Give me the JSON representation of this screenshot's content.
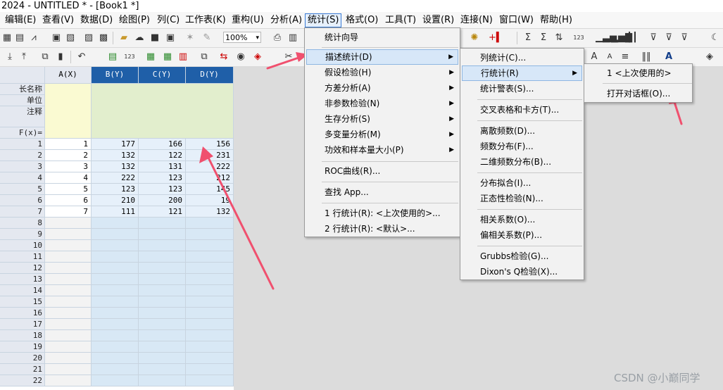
{
  "window": {
    "title": "2024 - UNTITLED * - [Book1 *]"
  },
  "menubar": [
    {
      "label": "编辑(E)"
    },
    {
      "label": "查看(V)"
    },
    {
      "label": "数据(D)"
    },
    {
      "label": "绘图(P)"
    },
    {
      "label": "列(C)"
    },
    {
      "label": "工作表(K)"
    },
    {
      "label": "重构(U)"
    },
    {
      "label": "分析(A)"
    },
    {
      "label": "统计(S)"
    },
    {
      "label": "格式(O)"
    },
    {
      "label": "工具(T)"
    },
    {
      "label": "设置(R)"
    },
    {
      "label": "连接(N)"
    },
    {
      "label": "窗口(W)"
    },
    {
      "label": "帮助(H)"
    }
  ],
  "toolbar": {
    "zoom": "100%"
  },
  "sheet": {
    "columns": [
      "A(X)",
      "B(Y)",
      "C(Y)",
      "D(Y)"
    ],
    "meta_rows": [
      "长名称",
      "单位",
      "注释",
      "F(x)="
    ],
    "rows": [
      [
        "1",
        "177",
        "166",
        "156"
      ],
      [
        "2",
        "132",
        "122",
        "231"
      ],
      [
        "3",
        "132",
        "131",
        "222"
      ],
      [
        "4",
        "222",
        "123",
        "212"
      ],
      [
        "5",
        "123",
        "123",
        "145"
      ],
      [
        "6",
        "210",
        "200",
        "19"
      ],
      [
        "7",
        "111",
        "121",
        "132"
      ]
    ],
    "row_numbers": [
      "1",
      "2",
      "3",
      "4",
      "5",
      "6",
      "7",
      "8",
      "9",
      "10",
      "11",
      "12",
      "13",
      "14",
      "15",
      "16",
      "17",
      "18",
      "19",
      "20",
      "21",
      "22"
    ]
  },
  "menu_stats": {
    "items": [
      "统计向导",
      "描述统计(D)",
      "假设检验(H)",
      "方差分析(A)",
      "非参数检验(N)",
      "生存分析(S)",
      "多变量分析(M)",
      "功效和样本量大小(P)",
      "ROC曲线(R)...",
      "查找 App...",
      "1 行统计(R): <上次使用的>...",
      "2 行统计(R): <默认>..."
    ]
  },
  "menu_desc": {
    "items": [
      "列统计(C)...",
      "行统计(R)",
      "统计警表(S)...",
      "交叉表格和卡方(T)...",
      "离散频数(D)...",
      "频数分布(F)...",
      "二维频数分布(B)...",
      "分布拟合(I)...",
      "正态性检验(N)...",
      "相关系数(O)...",
      "偏相关系数(P)...",
      "Grubbs检验(G)...",
      "Dixon's Q检验(X)..."
    ]
  },
  "menu_row": {
    "items": [
      "1 <上次使用的>",
      "打开对话框(O)..."
    ]
  },
  "watermark": "CSDN @小巅同学",
  "colors": {
    "accent": "#3a7bd5",
    "arrow": "#f0506e",
    "selected_column": "#d8e8f5",
    "meta_yellow": "#fafad2"
  }
}
